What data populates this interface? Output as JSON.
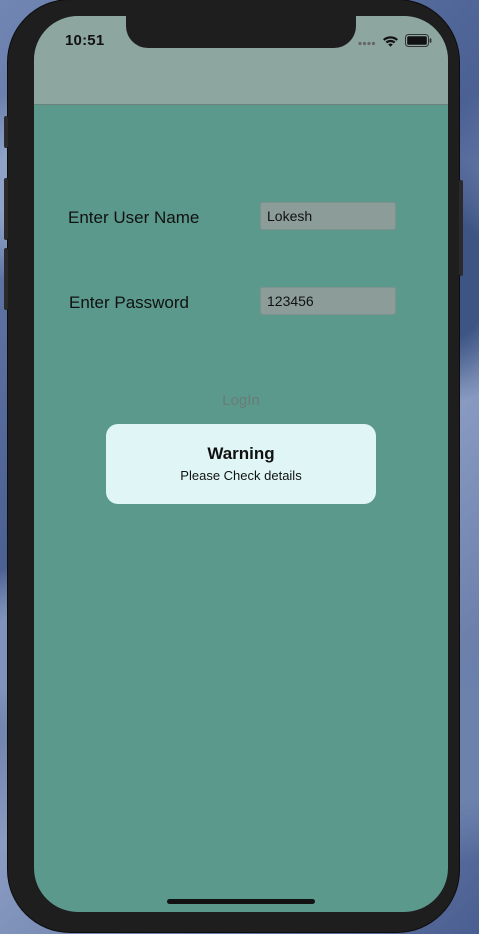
{
  "status_bar": {
    "time": "10:51",
    "icons": [
      "cellular-signal-icon",
      "wifi-icon",
      "battery-icon"
    ]
  },
  "form": {
    "username_label": "Enter User Name",
    "username_value": "Lokesh",
    "password_label": "Enter Password",
    "password_value": "123456",
    "login_label": "LogIn"
  },
  "alert": {
    "title": "Warning",
    "message": "Please Check details"
  },
  "colors": {
    "screen_background": "#5a998c",
    "navbar_background": "#8da69f",
    "alert_background": "#e0f6f6"
  }
}
